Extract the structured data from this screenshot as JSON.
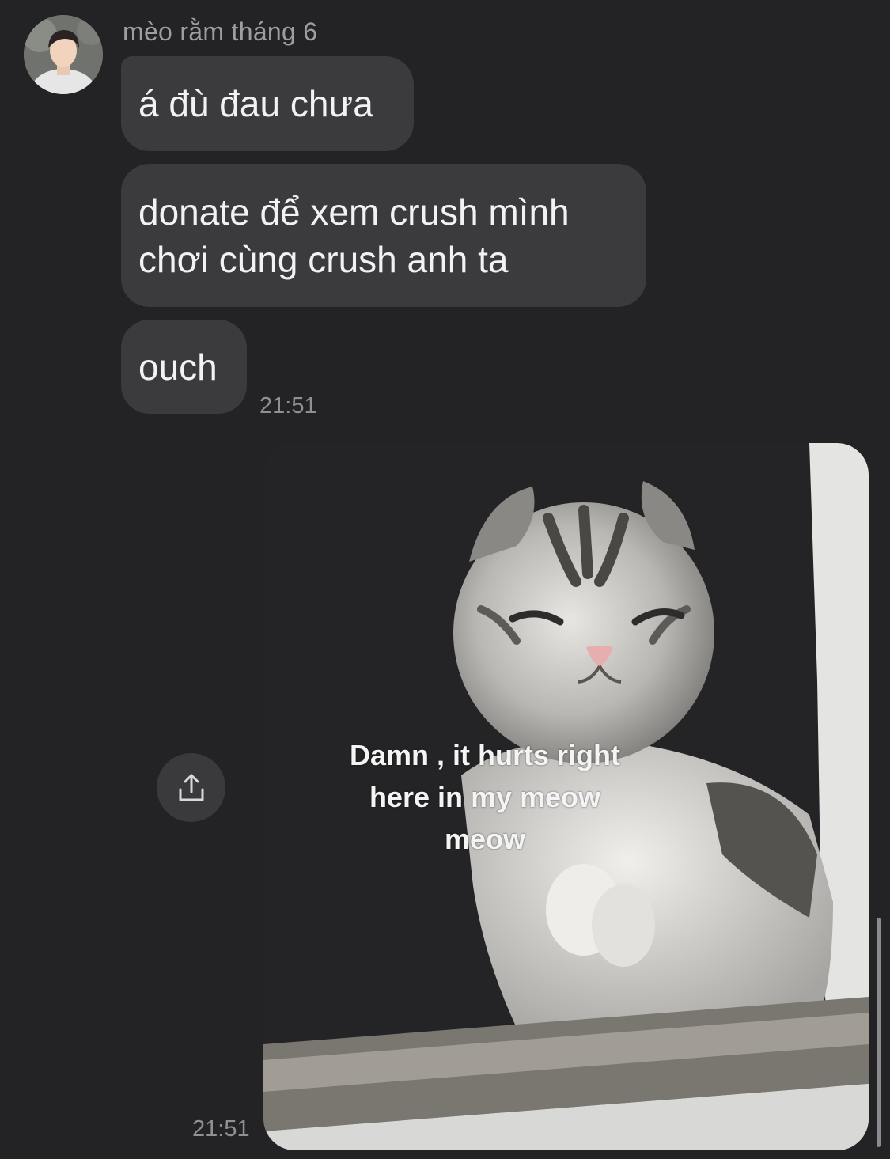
{
  "conversation": {
    "sender_name": "mèo rằm tháng 6",
    "avatar_icon": "profile-photo",
    "messages": [
      {
        "text": "á đù đau chưa"
      },
      {
        "lines": [
          "donate để xem crush mình",
          "chơi cùng crush anh ta"
        ]
      },
      {
        "text": "ouch"
      }
    ],
    "text_group_timestamp": "21:51",
    "image_message": {
      "caption_lines": [
        "Damn , it hurts right",
        "here in my meow",
        "meow"
      ],
      "timestamp": "21:51",
      "share_icon": "share-icon"
    }
  },
  "colors": {
    "background": "#232325",
    "bubble": "#3b3b3e",
    "text": "#f2f2f4",
    "muted": "#8f8f94"
  }
}
